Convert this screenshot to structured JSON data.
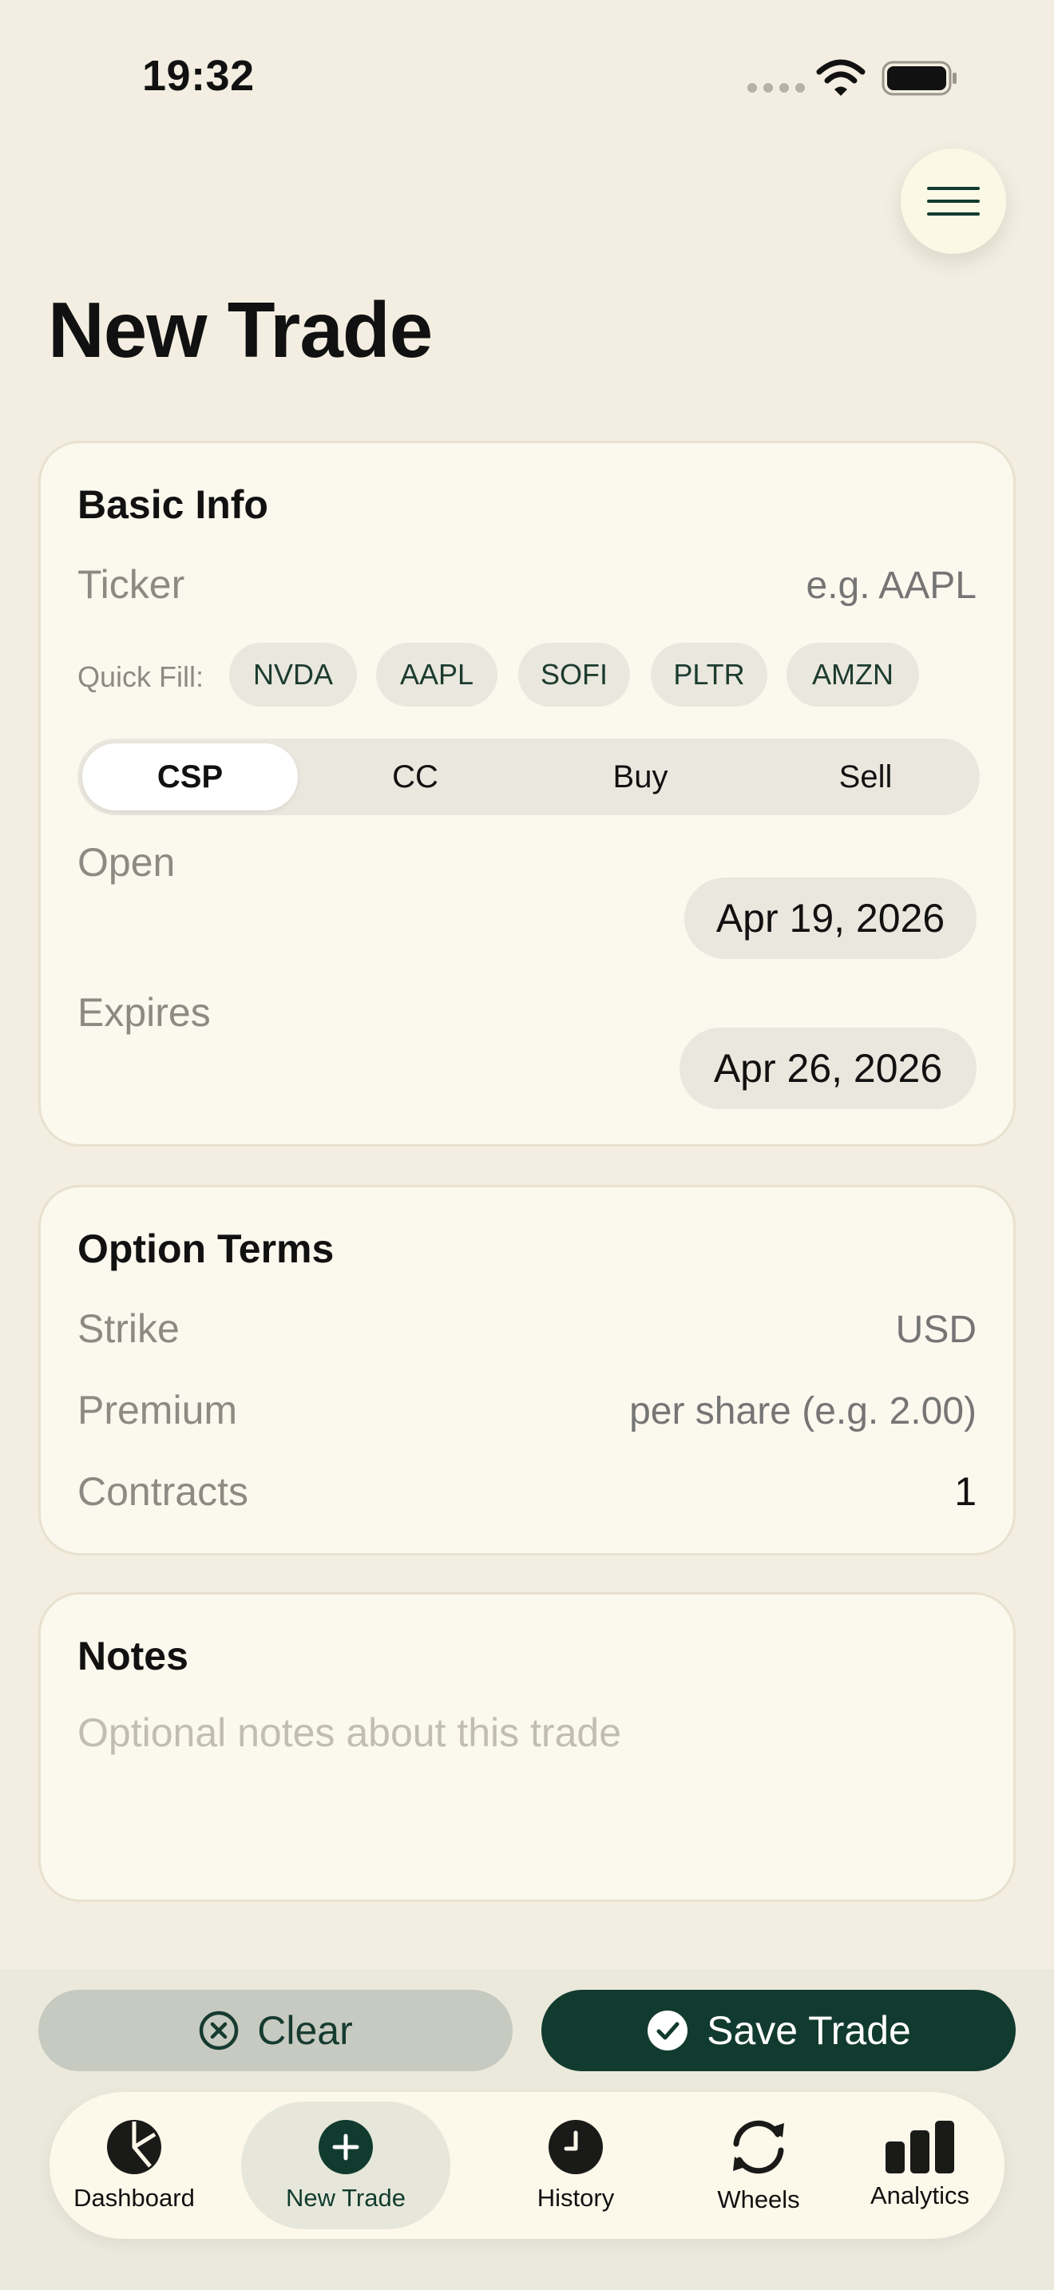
{
  "status": {
    "time": "19:32"
  },
  "page": {
    "title": "New Trade"
  },
  "basic_info": {
    "title": "Basic Info",
    "ticker_label": "Ticker",
    "ticker_placeholder": "e.g. AAPL",
    "quick_fill_label": "Quick Fill:",
    "quick_fill": [
      "NVDA",
      "AAPL",
      "SOFI",
      "PLTR",
      "AMZN"
    ],
    "trade_types": [
      "CSP",
      "CC",
      "Buy",
      "Sell"
    ],
    "selected_trade_type": "CSP",
    "open_label": "Open",
    "open_date": "Apr 19, 2026",
    "expires_label": "Expires",
    "expires_date": "Apr 26, 2026"
  },
  "option_terms": {
    "title": "Option Terms",
    "strike_label": "Strike",
    "strike_placeholder": "USD",
    "premium_label": "Premium",
    "premium_placeholder": "per share (e.g. 2.00)",
    "contracts_label": "Contracts",
    "contracts_value": "1"
  },
  "notes": {
    "title": "Notes",
    "placeholder": "Optional notes about this trade"
  },
  "actions": {
    "clear_label": "Clear",
    "save_label": "Save Trade"
  },
  "tabs": [
    {
      "label": "Dashboard",
      "icon": "pie-chart-icon"
    },
    {
      "label": "New Trade",
      "icon": "plus-circle-icon"
    },
    {
      "label": "History",
      "icon": "clock-icon"
    },
    {
      "label": "Wheels",
      "icon": "refresh-icon"
    },
    {
      "label": "Analytics",
      "icon": "bar-chart-icon"
    }
  ],
  "active_tab": "New Trade",
  "colors": {
    "accent": "#123B2F",
    "background": "#F3EEE1",
    "card": "#FBF8EE"
  }
}
